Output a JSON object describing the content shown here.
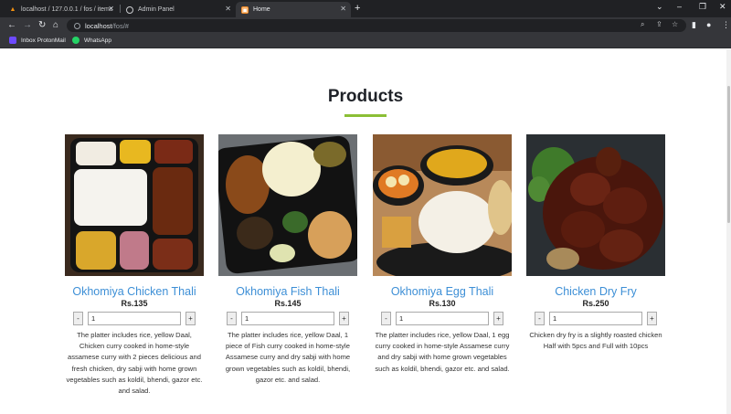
{
  "browser": {
    "tabs": [
      {
        "title": "localhost / 127.0.0.1 / fos / items"
      },
      {
        "title": "Admin Panel"
      },
      {
        "title": "Home"
      }
    ],
    "new_tab_glyph": "+",
    "address": {
      "host": "localhost",
      "path": "/fos/#"
    },
    "bookmarks": [
      {
        "label": "Inbox ProtonMail"
      },
      {
        "label": "WhatsApp"
      }
    ]
  },
  "page": {
    "heading": "Products",
    "accent_color": "#8bbf36",
    "title_color": "#3d8fd6"
  },
  "products": [
    {
      "name": "Okhomiya Chicken Thali",
      "price": "Rs.135",
      "qty": "1",
      "minus": "-",
      "plus": "+",
      "description": "The platter includes rice, yellow Daal, Chicken curry cooked in home-style assamese curry with 2 pieces delicious and fresh chicken, dry sabji with home grown vegetables such as koldil, bhendi, gazor etc. and salad."
    },
    {
      "name": "Okhomiya Fish Thali",
      "price": "Rs.145",
      "qty": "1",
      "minus": "-",
      "plus": "+",
      "description": "The platter includes rice, yellow Daal, 1 piece of Fish curry cooked in home-style Assamese curry and dry sabji with home grown vegetables such as koldil, bhendi, gazor etc. and salad."
    },
    {
      "name": "Okhomiya Egg Thali",
      "price": "Rs.130",
      "qty": "1",
      "minus": "-",
      "plus": "+",
      "description": "The platter includes rice, yellow Daal, 1 egg curry cooked in home-style Assamese curry and dry sabji with home grown vegetables such as koldil, bhendi, gazor etc. and salad."
    },
    {
      "name": "Chicken Dry Fry",
      "price": "Rs.250",
      "qty": "1",
      "minus": "-",
      "plus": "+",
      "description": "Chicken dry fry is a slightly roasted chicken Half with 5pcs and Full with 10pcs"
    }
  ]
}
